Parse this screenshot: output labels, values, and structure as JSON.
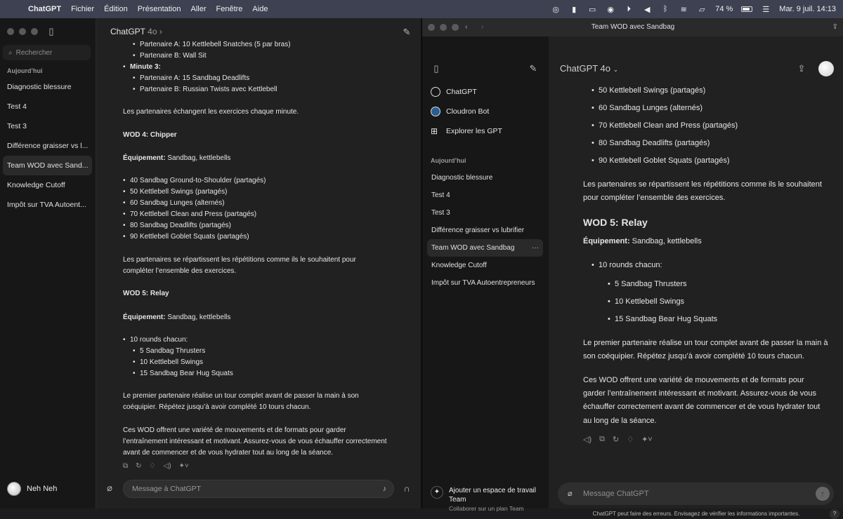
{
  "menubar": {
    "app": "ChatGPT",
    "items": [
      "Fichier",
      "Édition",
      "Présentation",
      "Aller",
      "Fenêtre",
      "Aide"
    ],
    "battery": "74 %",
    "datetime": "Mar. 9 juil.  14:13"
  },
  "w1": {
    "search_placeholder": "Rechercher",
    "section": "Aujourd’hui",
    "history": [
      "Diagnostic blessure",
      "Test 4",
      "Test 3",
      "Différence graisser vs l...",
      "Team WOD avec Sand...",
      "Knowledge Cutoff",
      "Impôt sur TVA Autoent..."
    ],
    "user": "Neh Neh",
    "model": "ChatGPT",
    "model_ver": "4o ›",
    "lines": [
      {
        "t": "Partenaire A: 10 Kettlebell Snatches (5 par bras)",
        "ind": 2
      },
      {
        "t": "Partenaire B: Wall Sit",
        "ind": 2
      },
      {
        "t": "Minute 3:",
        "ind": 1,
        "bold": true
      },
      {
        "t": "Partenaire A: 15 Sandbag Deadlifts",
        "ind": 2
      },
      {
        "t": "Partenaire B: Russian Twists avec Kettlebell",
        "ind": 2
      },
      {
        "t": "Les partenaires échangent les exercices chaque minute.",
        "ind": 0
      },
      {
        "t": "WOD 4: Chipper",
        "ind": 0,
        "bold": true
      },
      {
        "t": "Équipement: Sandbag, kettlebells",
        "ind": 0,
        "lead": "Équipement:"
      },
      {
        "t": "40 Sandbag Ground-to-Shoulder (partagés)",
        "ind": 1
      },
      {
        "t": "50 Kettlebell Swings (partagés)",
        "ind": 1
      },
      {
        "t": "60 Sandbag Lunges (alternés)",
        "ind": 1
      },
      {
        "t": "70 Kettlebell Clean and Press (partagés)",
        "ind": 1
      },
      {
        "t": "80 Sandbag Deadlifts (partagés)",
        "ind": 1
      },
      {
        "t": "90 Kettlebell Goblet Squats (partagés)",
        "ind": 1
      },
      {
        "t": "Les partenaires se répartissent les répétitions comme ils le souhaitent pour",
        "ind": 0
      },
      {
        "t": "compléter l’ensemble des exercices.",
        "ind": 0
      },
      {
        "t": "WOD 5: Relay",
        "ind": 0,
        "bold": true
      },
      {
        "t": "Équipement: Sandbag, kettlebells",
        "ind": 0,
        "lead": "Équipement:"
      },
      {
        "t": "10 rounds chacun:",
        "ind": 1
      },
      {
        "t": "5 Sandbag Thrusters",
        "ind": 2
      },
      {
        "t": "10 Kettlebell Swings",
        "ind": 2
      },
      {
        "t": "15 Sandbag Bear Hug Squats",
        "ind": 2
      },
      {
        "t": "Le premier partenaire réalise un tour complet avant de passer la main à son",
        "ind": 0
      },
      {
        "t": "coéquipier. Répétez jusqu’à avoir complété 10 tours chacun.",
        "ind": 0
      },
      {
        "t": "Ces WOD offrent une variété de mouvements et de formats pour garder",
        "ind": 0
      },
      {
        "t": "l’entraînement intéressant et motivant. Assurez-vous de vous échauffer correctement",
        "ind": 0
      },
      {
        "t": "avant de commencer et de vous hydrater tout au long de la séance.",
        "ind": 0
      }
    ],
    "input_placeholder": "Message à ChatGPT"
  },
  "w2": {
    "title": "Team WOD avec Sandbag",
    "nav": [
      "ChatGPT",
      "Cloudron Bot",
      "Explorer les GPT"
    ],
    "section": "Aujourd’hui",
    "history": [
      "Diagnostic blessure",
      "Test 4",
      "Test 3",
      "Différence graisser vs lubrifier",
      "Team WOD avec Sandbag",
      "Knowledge Cutoff",
      "Impôt sur TVA Autoentrepreneurs"
    ],
    "team_title": "Ajouter un espace de travail",
    "team_title2": "Team",
    "team_sub": "Collaborer sur un plan Team",
    "model": "ChatGPT 4o",
    "lines": [
      {
        "t": "50 Kettlebell Swings (partagés)",
        "ind": 1
      },
      {
        "t": "60 Sandbag Lunges (alternés)",
        "ind": 1
      },
      {
        "t": "70 Kettlebell Clean and Press (partagés)",
        "ind": 1
      },
      {
        "t": "80 Sandbag Deadlifts (partagés)",
        "ind": 1
      },
      {
        "t": "90 Kettlebell Goblet Squats (partagés)",
        "ind": 1
      },
      {
        "t": "Les partenaires se répartissent les répétitions comme ils le souhaitent",
        "ind": 0
      },
      {
        "t": "pour compléter l’ensemble des exercices.",
        "ind": 0
      },
      {
        "t": "WOD 5: Relay",
        "ind": 0,
        "h": true
      },
      {
        "t": "Équipement: Sandbag, kettlebells",
        "ind": 0,
        "lead": "Équipement:"
      },
      {
        "t": "10 rounds chacun:",
        "ind": 1
      },
      {
        "t": "5 Sandbag Thrusters",
        "ind": 2
      },
      {
        "t": "10 Kettlebell Swings",
        "ind": 2
      },
      {
        "t": "15 Sandbag Bear Hug Squats",
        "ind": 2
      },
      {
        "t": "Le premier partenaire réalise un tour complet avant de passer la main à",
        "ind": 0
      },
      {
        "t": "son coéquipier. Répétez jusqu’à avoir complété 10 tours chacun.",
        "ind": 0
      },
      {
        "t": "Ces WOD offrent une variété de mouvements et de formats pour",
        "ind": 0
      },
      {
        "t": "garder l’entraînement intéressant et motivant. Assurez-vous de vous",
        "ind": 0
      },
      {
        "t": "échauffer correctement avant de commencer et de vous hydrater tout",
        "ind": 0
      },
      {
        "t": "au long de la séance.",
        "ind": 0
      }
    ],
    "input_placeholder": "Message ChatGPT",
    "footer": "ChatGPT peut faire des erreurs. Envisagez de vérifier les informations importantes.",
    "help": "?"
  }
}
